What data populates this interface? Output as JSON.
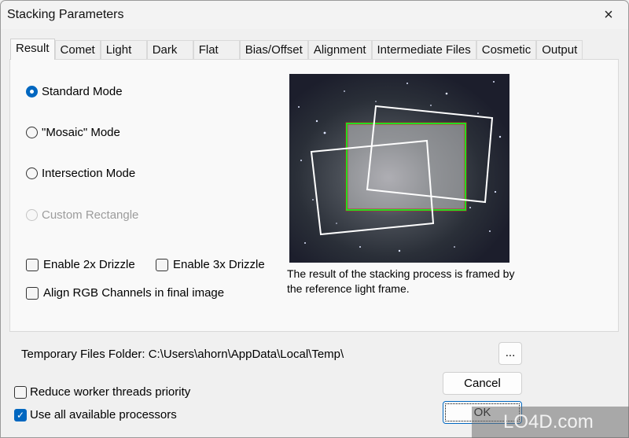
{
  "window": {
    "title": "Stacking Parameters",
    "close_icon": "×"
  },
  "tabs": [
    {
      "label": "Result",
      "active": true
    },
    {
      "label": "Comet"
    },
    {
      "label": "Light"
    },
    {
      "label": "Dark"
    },
    {
      "label": "Flat"
    },
    {
      "label": "Bias/Offset"
    },
    {
      "label": "Alignment"
    },
    {
      "label": "Intermediate Files"
    },
    {
      "label": "Cosmetic"
    },
    {
      "label": "Output"
    }
  ],
  "result": {
    "modes": [
      {
        "label": "Standard Mode",
        "checked": true,
        "enabled": true
      },
      {
        "label": "\"Mosaic\" Mode",
        "checked": false,
        "enabled": true
      },
      {
        "label": "Intersection Mode",
        "checked": false,
        "enabled": true
      },
      {
        "label": "Custom Rectangle",
        "checked": false,
        "enabled": false
      }
    ],
    "options": {
      "drizzle2x": {
        "label": "Enable 2x Drizzle",
        "checked": false
      },
      "drizzle3x": {
        "label": "Enable 3x Drizzle",
        "checked": false
      },
      "align_rgb": {
        "label": "Align RGB Channels in final image",
        "checked": false
      }
    },
    "preview_caption": "The result of the stacking process is framed by the reference light frame.",
    "colors": {
      "reference_frame": "#22dd22",
      "reference_edge": "#cc2222",
      "frames": "#ffffff"
    }
  },
  "footer": {
    "temp_folder_label": "Temporary Files Folder:",
    "temp_folder_path": "C:\\Users\\ahorn\\AppData\\Local\\Temp\\",
    "browse_label": "...",
    "reduce_priority": {
      "label": "Reduce worker threads priority",
      "checked": false
    },
    "use_all_processors": {
      "label": "Use all available processors",
      "checked": true
    },
    "cancel_label": "Cancel",
    "ok_label": "OK"
  },
  "watermark": "LO4D.com"
}
